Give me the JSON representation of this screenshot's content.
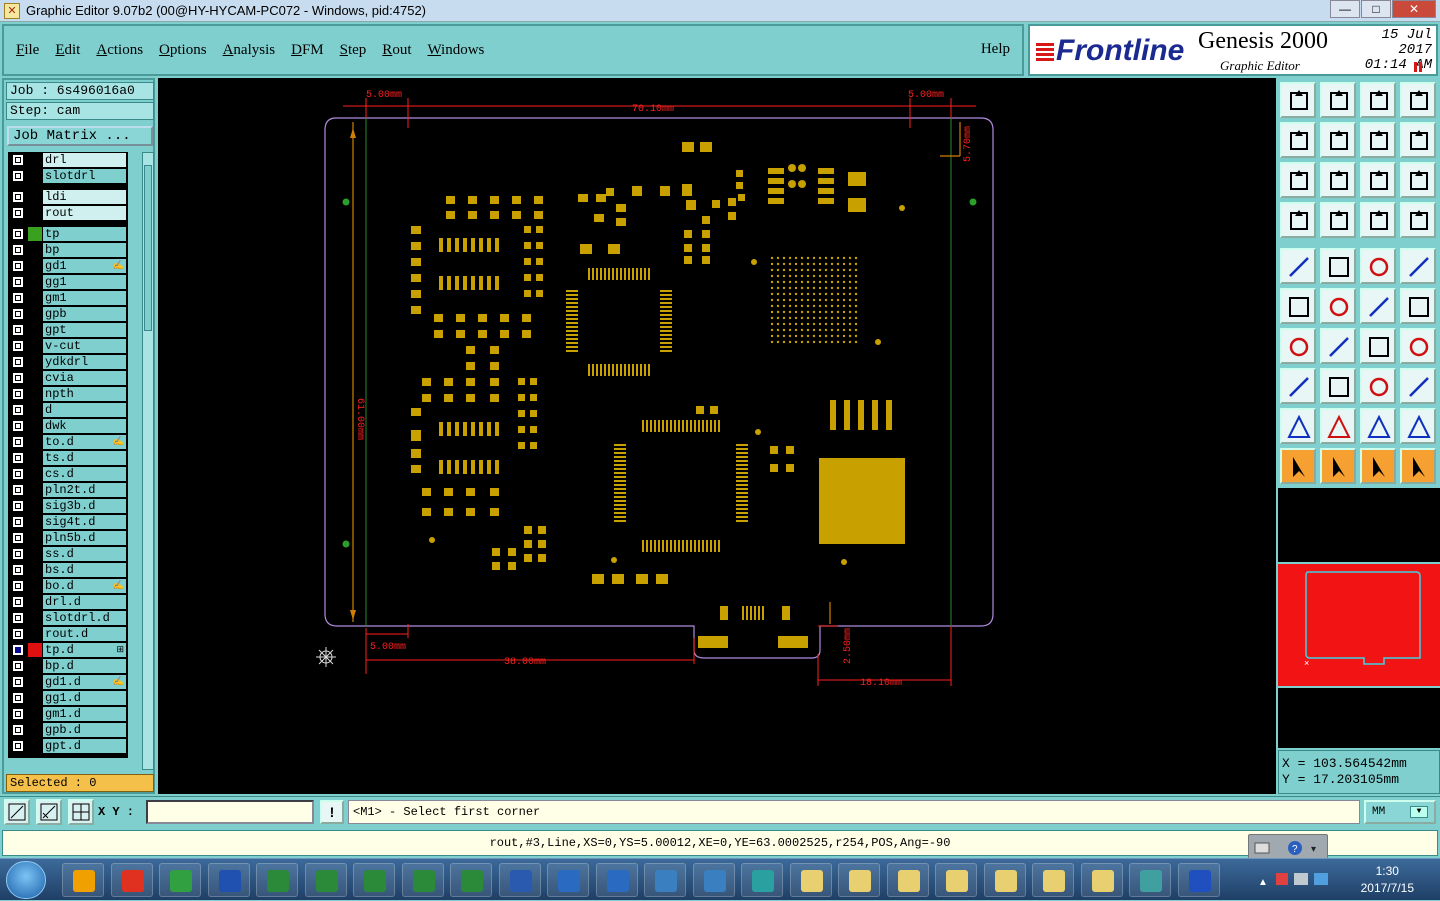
{
  "window": {
    "title": "Graphic Editor 9.07b2 (00@HY-HYCAM-PC072 - Windows, pid:4752)",
    "minimize": "—",
    "maximize": "□",
    "close": "✕"
  },
  "menu": {
    "items": [
      {
        "ul": "F",
        "rest": "ile"
      },
      {
        "ul": "E",
        "rest": "dit"
      },
      {
        "ul": "A",
        "rest": "ctions"
      },
      {
        "ul": "O",
        "rest": "ptions"
      },
      {
        "ul": "A",
        "rest": "nalysis"
      },
      {
        "ul": "D",
        "rest": "FM"
      },
      {
        "ul": "S",
        "rest": "tep"
      },
      {
        "ul": "R",
        "rest": "out"
      },
      {
        "ul": "W",
        "rest": "indows"
      }
    ],
    "help": "Help"
  },
  "brand": {
    "logo": "Frontline",
    "product": "Genesis 2000",
    "subtitle": "Graphic Editor",
    "date": "15 Jul 2017",
    "time": "01:14 AM"
  },
  "job": {
    "job_label": "Job : 6s496016a0",
    "step_label": "Step: cam",
    "matrix_button": "Job Matrix ..."
  },
  "layers": [
    {
      "name": "drl",
      "color": "#000000",
      "light": true,
      "gap": false,
      "mark": ""
    },
    {
      "name": "slotdrl",
      "color": "#000000",
      "light": false,
      "gap": false,
      "mark": ""
    },
    {
      "name": "ldi",
      "color": "#000000",
      "light": true,
      "gap": true,
      "mark": ""
    },
    {
      "name": "rout",
      "color": "#000000",
      "light": true,
      "gap": false,
      "mark": ""
    },
    {
      "name": "tp",
      "color": "#3aa020",
      "light": false,
      "gap": true,
      "mark": ""
    },
    {
      "name": "bp",
      "color": "#000000",
      "light": false,
      "gap": false,
      "mark": ""
    },
    {
      "name": "gd1",
      "color": "#000000",
      "light": false,
      "gap": false,
      "mark": "✍"
    },
    {
      "name": "gg1",
      "color": "#000000",
      "light": false,
      "gap": false,
      "mark": ""
    },
    {
      "name": "gm1",
      "color": "#000000",
      "light": false,
      "gap": false,
      "mark": ""
    },
    {
      "name": "gpb",
      "color": "#000000",
      "light": false,
      "gap": false,
      "mark": ""
    },
    {
      "name": "gpt",
      "color": "#000000",
      "light": false,
      "gap": false,
      "mark": ""
    },
    {
      "name": "v-cut",
      "color": "#000000",
      "light": false,
      "gap": false,
      "mark": ""
    },
    {
      "name": "ydkdrl",
      "color": "#000000",
      "light": false,
      "gap": false,
      "mark": ""
    },
    {
      "name": "cvia",
      "color": "#000000",
      "light": false,
      "gap": false,
      "mark": ""
    },
    {
      "name": "npth",
      "color": "#000000",
      "light": false,
      "gap": false,
      "mark": ""
    },
    {
      "name": "d",
      "color": "#000000",
      "light": false,
      "gap": false,
      "mark": ""
    },
    {
      "name": "dwk",
      "color": "#000000",
      "light": false,
      "gap": false,
      "mark": ""
    },
    {
      "name": "to.d",
      "color": "#000000",
      "light": false,
      "gap": false,
      "mark": "✍"
    },
    {
      "name": "ts.d",
      "color": "#000000",
      "light": false,
      "gap": false,
      "mark": ""
    },
    {
      "name": "cs.d",
      "color": "#000000",
      "light": false,
      "gap": false,
      "mark": ""
    },
    {
      "name": "pln2t.d",
      "color": "#000000",
      "light": false,
      "gap": false,
      "mark": ""
    },
    {
      "name": "sig3b.d",
      "color": "#000000",
      "light": false,
      "gap": false,
      "mark": ""
    },
    {
      "name": "sig4t.d",
      "color": "#000000",
      "light": false,
      "gap": false,
      "mark": ""
    },
    {
      "name": "pln5b.d",
      "color": "#000000",
      "light": false,
      "gap": false,
      "mark": ""
    },
    {
      "name": "ss.d",
      "color": "#000000",
      "light": false,
      "gap": false,
      "mark": ""
    },
    {
      "name": "bs.d",
      "color": "#000000",
      "light": false,
      "gap": false,
      "mark": ""
    },
    {
      "name": "bo.d",
      "color": "#000000",
      "light": false,
      "gap": false,
      "mark": "✍"
    },
    {
      "name": "drl.d",
      "color": "#000000",
      "light": false,
      "gap": false,
      "mark": ""
    },
    {
      "name": "slotdrl.d",
      "color": "#000000",
      "light": false,
      "gap": false,
      "mark": ""
    },
    {
      "name": "rout.d",
      "color": "#000000",
      "light": false,
      "gap": false,
      "mark": ""
    },
    {
      "name": "tp.d",
      "color": "#e01010",
      "light": false,
      "gap": false,
      "mark": "⊞",
      "checked": true
    },
    {
      "name": "bp.d",
      "color": "#000000",
      "light": false,
      "gap": false,
      "mark": ""
    },
    {
      "name": "gd1.d",
      "color": "#000000",
      "light": false,
      "gap": false,
      "mark": "✍"
    },
    {
      "name": "gg1.d",
      "color": "#000000",
      "light": false,
      "gap": false,
      "mark": ""
    },
    {
      "name": "gm1.d",
      "color": "#000000",
      "light": false,
      "gap": false,
      "mark": ""
    },
    {
      "name": "gpb.d",
      "color": "#000000",
      "light": false,
      "gap": false,
      "mark": ""
    },
    {
      "name": "gpt.d",
      "color": "#000000",
      "light": false,
      "gap": false,
      "mark": ""
    }
  ],
  "selected_label": "Selected : 0",
  "canvas": {
    "dim_top_left": "5.00mm",
    "dim_top_mid": "70.10mm",
    "dim_top_right": "5.00mm",
    "dim_right": "5.70mm",
    "dim_left": "61.00mm",
    "dim_bottom_left": "5.00mm",
    "dim_bottom_mid": "38.00mm",
    "dim_bottom_right": "18.10mm",
    "dim_notch": "2.50mm",
    "pad_color": "#c8a000",
    "dim_color": "#ff2020",
    "outline_color": "#b08be0",
    "route_color": "#d08000"
  },
  "coords": {
    "x": "X = 103.564542mm",
    "y": "Y = 17.203105mm"
  },
  "command": {
    "xy_label": "X Y :",
    "xy_value": "",
    "excl": "!",
    "prompt": "<M1> - Select first corner",
    "unit": "MM"
  },
  "status_line": "rout,#3,Line,XS=0,YS=5.00012,XE=0,YE=63.0002525,r254,POS,Ang=-90",
  "taskbar": {
    "time": "1:30",
    "date": "2017/7/15"
  }
}
